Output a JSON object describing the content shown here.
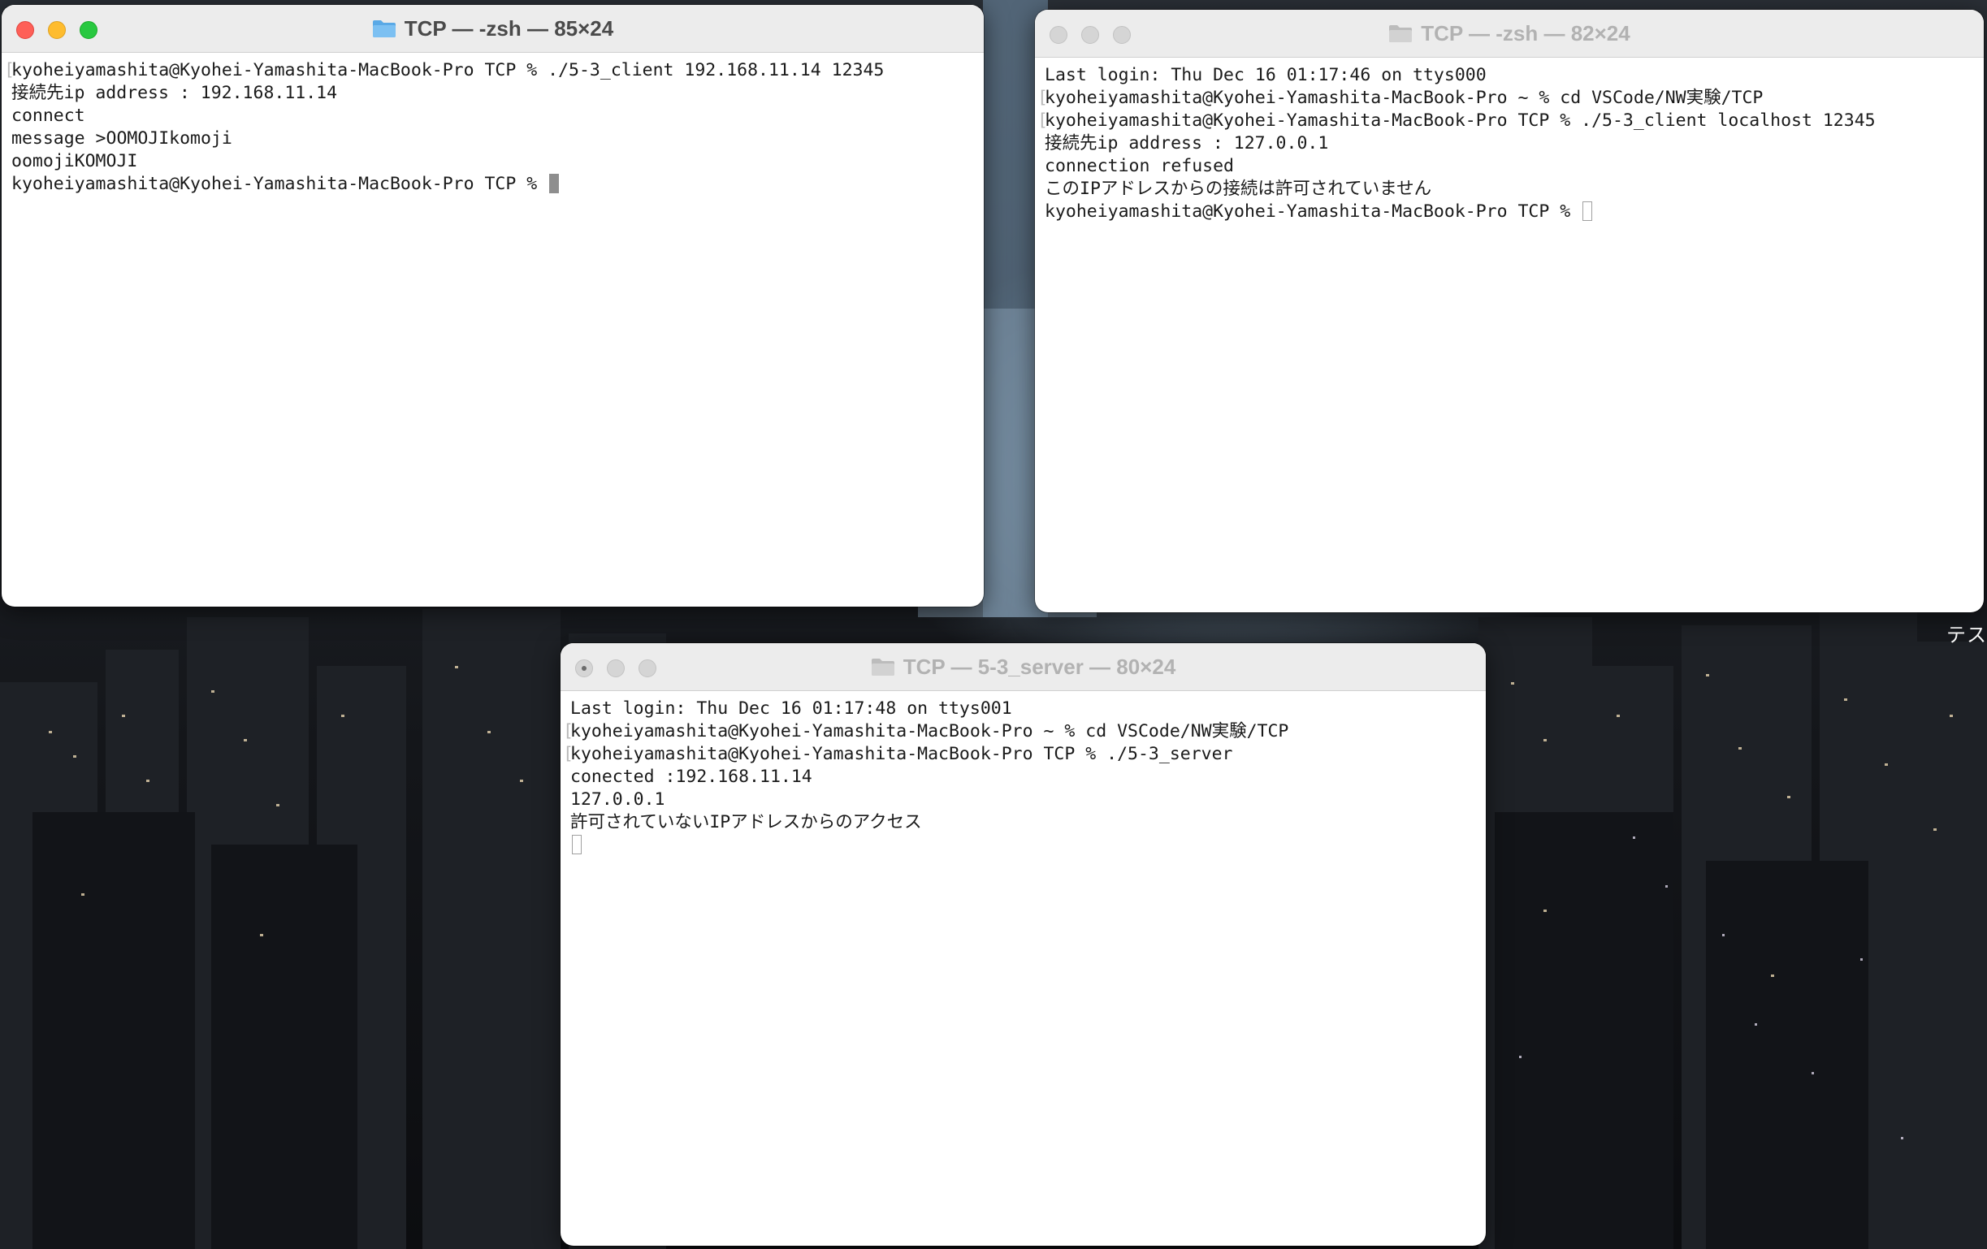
{
  "desktop": {
    "wallpaper": "dark futuristic cityscape at night",
    "side_label": "テス"
  },
  "windows": [
    {
      "id": "client-window-1",
      "active": true,
      "title": "TCP — -zsh — 85×24",
      "title_icon": "folder-icon",
      "lines": [
        {
          "text": "kyoheiyamashita@Kyohei-Yamashita-MacBook-Pro TCP % ./5-3_client 192.168.11.14 12345",
          "bracketed": true
        },
        {
          "text": "接続先ip address : 192.168.11.14",
          "bracketed": false
        },
        {
          "text": "connect",
          "bracketed": false
        },
        {
          "text": "message >OOMOJIkomoji",
          "bracketed": false
        },
        {
          "text": "oomojiKOMOJI",
          "bracketed": false
        },
        {
          "text": "kyoheiyamashita@Kyohei-Yamashita-MacBook-Pro TCP % ",
          "bracketed": false,
          "cursor": "solid"
        }
      ]
    },
    {
      "id": "client-window-2",
      "active": false,
      "title": "TCP — -zsh — 82×24",
      "title_icon": "folder-icon",
      "lines": [
        {
          "text": "Last login: Thu Dec 16 01:17:46 on ttys000",
          "bracketed": false
        },
        {
          "text": "kyoheiyamashita@Kyohei-Yamashita-MacBook-Pro ~ % cd VSCode/NW実験/TCP",
          "bracketed": true
        },
        {
          "text": "kyoheiyamashita@Kyohei-Yamashita-MacBook-Pro TCP % ./5-3_client localhost 12345",
          "bracketed": true
        },
        {
          "text": "接続先ip address : 127.0.0.1",
          "bracketed": false
        },
        {
          "text": "connection refused",
          "bracketed": false
        },
        {
          "text": "このIPアドレスからの接続は許可されていません",
          "bracketed": false
        },
        {
          "text": "kyoheiyamashita@Kyohei-Yamashita-MacBook-Pro TCP % ",
          "bracketed": false,
          "cursor": "hollow"
        }
      ]
    },
    {
      "id": "server-window",
      "active": false,
      "title": "TCP — 5-3_server — 80×24",
      "title_icon": "folder-icon",
      "lines": [
        {
          "text": "Last login: Thu Dec 16 01:17:48 on ttys001",
          "bracketed": false
        },
        {
          "text": "kyoheiyamashita@Kyohei-Yamashita-MacBook-Pro ~ % cd VSCode/NW実験/TCP",
          "bracketed": true
        },
        {
          "text": "kyoheiyamashita@Kyohei-Yamashita-MacBook-Pro TCP % ./5-3_server",
          "bracketed": true
        },
        {
          "text": "conected :192.168.11.14",
          "bracketed": false
        },
        {
          "text": "127.0.0.1",
          "bracketed": false
        },
        {
          "text": "許可されていないIPアドレスからのアクセス",
          "bracketed": false
        },
        {
          "text": "",
          "bracketed": false,
          "cursor": "hollow"
        }
      ]
    }
  ],
  "colors": {
    "close": "#fe5f57",
    "minimize": "#febc2e",
    "zoom": "#28c840",
    "folder_active": "#5aa9e6",
    "folder_inactive": "#c8c8c8"
  }
}
